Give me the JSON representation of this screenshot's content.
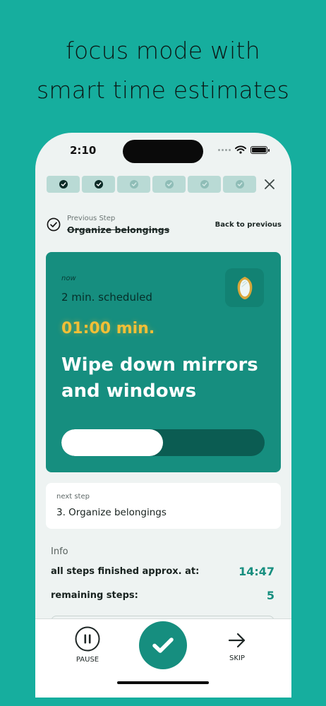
{
  "headline": {
    "line1": "focus mode with",
    "line2": "smart time estimates"
  },
  "status_bar": {
    "time": "2:10"
  },
  "step_progress": {
    "segments": [
      "done",
      "done",
      "todo",
      "todo",
      "todo",
      "todo"
    ]
  },
  "previous": {
    "label": "Previous Step",
    "step": "Organize belongings",
    "back_link": "Back to previous"
  },
  "current": {
    "now_label": "now",
    "scheduled": "2 min. scheduled",
    "timer": "01:00 min.",
    "title": "Wipe down mirrors and windows",
    "icon": "mirror-icon",
    "progress_fraction": 0.5
  },
  "next": {
    "label": "next step",
    "step": "3. Organize belongings"
  },
  "info": {
    "title": "Info",
    "finished_label": "all steps finished approx. at:",
    "finished_value": "14:47",
    "remaining_label": "remaining steps:",
    "remaining_value": "5"
  },
  "controls": {
    "pause_label": "PAUSE",
    "skip_label": "SKIP"
  },
  "colors": {
    "background": "#16ae9e",
    "accent": "#168e7f",
    "timer": "#f2bf36"
  }
}
